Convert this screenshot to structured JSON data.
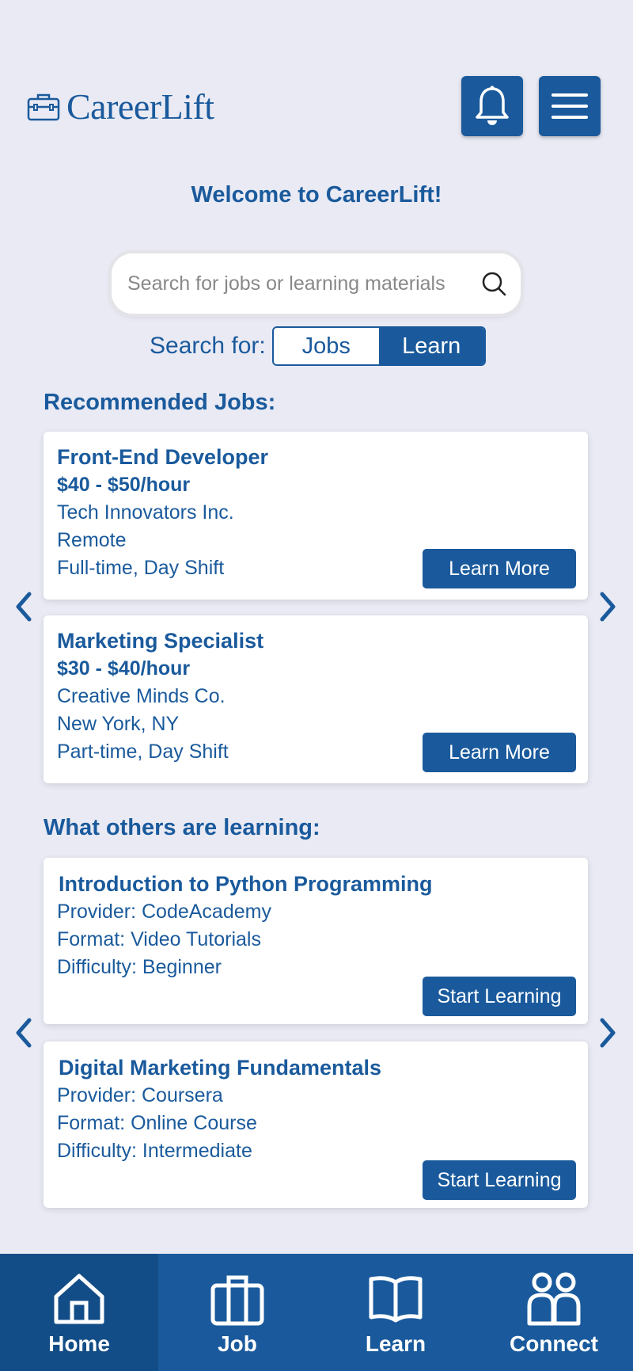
{
  "header": {
    "app_name": "CareerLift",
    "logo_icon": "briefcase-icon",
    "bell_icon": "bell-icon",
    "menu_icon": "hamburger-menu-icon"
  },
  "welcome": "Welcome to CareerLift!",
  "search": {
    "placeholder": "Search for jobs or learning materials",
    "value": "",
    "icon": "search-icon",
    "search_for_label": "Search for:",
    "options": [
      "Jobs",
      "Learn"
    ],
    "selected": "Learn"
  },
  "jobs_section": {
    "title": "Recommended Jobs:",
    "items": [
      {
        "title": "Front-End Developer",
        "pay": "$40 - $50/hour",
        "company": "Tech Innovators Inc.",
        "location": "Remote",
        "type": "Full-time, Day Shift",
        "button": "Learn More"
      },
      {
        "title": "Marketing Specialist",
        "pay": "$30 - $40/hour",
        "company": "Creative Minds Co.",
        "location": "New York, NY",
        "type": "Part-time, Day Shift",
        "button": "Learn More"
      }
    ]
  },
  "learning_section": {
    "title": "What others are learning:",
    "items": [
      {
        "title": "Introduction to Python Programming",
        "provider": "Provider: CodeAcademy",
        "format": "Format: Video Tutorials",
        "difficulty": "Difficulty: Beginner",
        "button": "Start Learning"
      },
      {
        "title": "Digital Marketing Fundamentals",
        "provider": "Provider: Coursera",
        "format": "Format: Online Course",
        "difficulty": "Difficulty: Intermediate",
        "button": "Start Learning"
      }
    ]
  },
  "bottom_nav": {
    "items": [
      {
        "label": "Home",
        "icon": "home-icon",
        "active": true
      },
      {
        "label": "Job",
        "icon": "briefcase-icon",
        "active": false
      },
      {
        "label": "Learn",
        "icon": "book-icon",
        "active": false
      },
      {
        "label": "Connect",
        "icon": "people-icon",
        "active": false
      }
    ]
  },
  "colors": {
    "primary": "#1A5A9C",
    "background": "#E9EAF4",
    "active_nav": "#134D87"
  }
}
